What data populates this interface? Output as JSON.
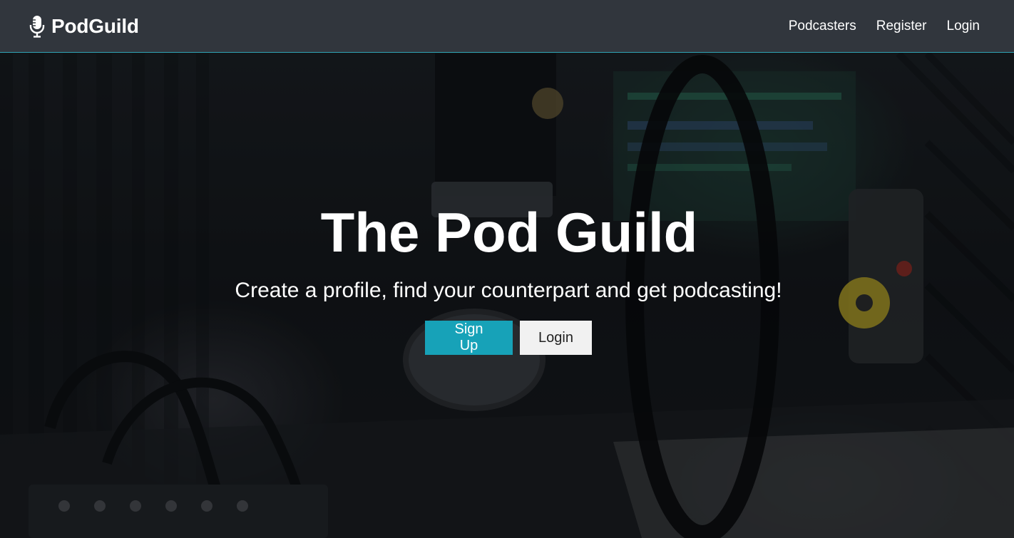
{
  "navbar": {
    "brand_icon": "microphone-icon",
    "brand_label": "PodGuild",
    "links": [
      {
        "label": "Podcasters"
      },
      {
        "label": "Register"
      },
      {
        "label": "Login"
      }
    ]
  },
  "hero": {
    "title": "The Pod Guild",
    "subtitle": "Create a profile, find your counterpart and get podcasting!",
    "signup_label": "Sign Up",
    "login_label": "Login"
  },
  "colors": {
    "navbar_bg": "#343a40",
    "accent": "#17a2b8",
    "light_button": "#f1f1f1"
  }
}
